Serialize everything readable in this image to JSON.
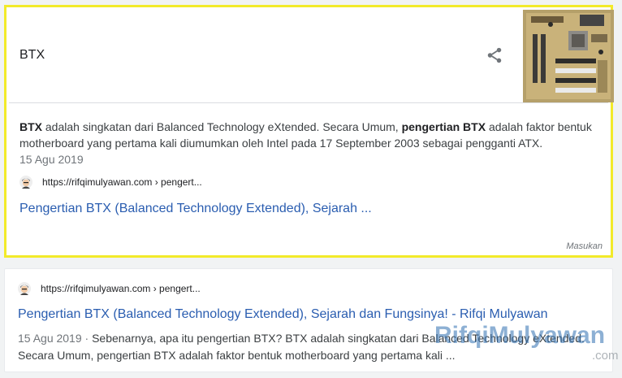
{
  "featured": {
    "query": "BTX",
    "snippet_parts": {
      "b1": "BTX",
      "t1": " adalah singkatan dari Balanced Technology eXtended. Secara Umum, ",
      "b2": "pengertian BTX",
      "t2": " adalah faktor bentuk motherboard yang pertama kali diumumkan oleh Intel pada 17 September 2003 sebagai pengganti ATX."
    },
    "date": "15 Agu 2019",
    "source_url": "https://rifqimulyawan.com › pengert...",
    "link_title": "Pengertian BTX (Balanced Technology Extended), Sejarah ...",
    "feedback_label": "Masukan",
    "share_icon": "share-icon"
  },
  "result": {
    "source_url": "https://rifqimulyawan.com › pengert...",
    "title": "Pengertian BTX (Balanced Technology Extended), Sejarah dan Fungsinya! - Rifqi Mulyawan",
    "date": "15 Agu 2019",
    "separator": " · ",
    "description": "Sebenarnya, apa itu pengertian BTX? BTX adalah singkatan dari Balanced Technology eXtended. Secara Umum, pengertian BTX adalah faktor bentuk motherboard yang pertama kali ..."
  },
  "watermark": {
    "name": "RifqiMulyawan",
    "suffix": ".com"
  },
  "colors": {
    "highlight_border": "#f2ea2a",
    "link": "#2a5db0",
    "watermark_blue": "#2f6fb0"
  }
}
